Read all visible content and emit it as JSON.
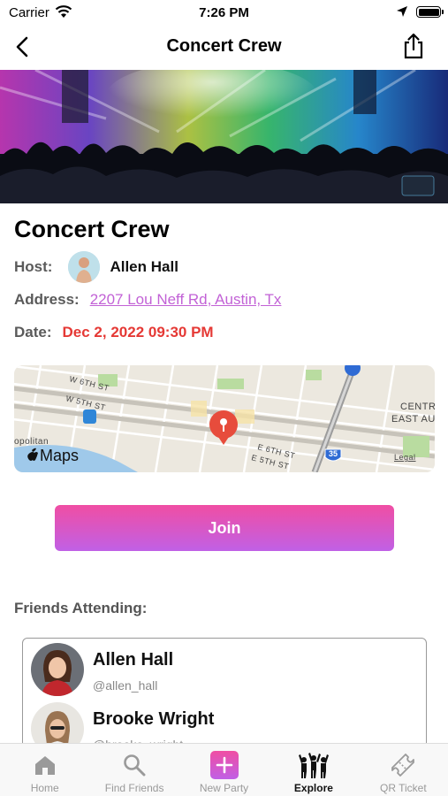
{
  "status_bar": {
    "carrier": "Carrier",
    "time": "7:26 PM"
  },
  "nav": {
    "title": "Concert Crew",
    "back_icon": "chevron-left-icon",
    "share_icon": "share-icon"
  },
  "event": {
    "title": "Concert Crew",
    "host_label": "Host:",
    "host_name": "Allen Hall",
    "address_label": "Address:",
    "address": "2207 Lou Neff Rd, Austin, Tx",
    "date_label": "Date:",
    "date": "Dec 2, 2022 09:30 PM"
  },
  "map": {
    "streets": [
      "W 6TH ST",
      "W 5TH ST",
      "E 6TH ST",
      "E 5TH ST"
    ],
    "places": [
      "CENTR",
      "EAST AU",
      "opolitan"
    ],
    "highway": "35",
    "brand": "Maps",
    "legal": "Legal"
  },
  "join_button": "Join",
  "friends": {
    "label": "Friends Attending:",
    "list": [
      {
        "name": "Allen Hall",
        "handle": "@allen_hall"
      },
      {
        "name": "Brooke Wright",
        "handle": "@brooke_wright"
      }
    ]
  },
  "tabs": [
    {
      "label": "Home",
      "icon": "home-icon",
      "active": false
    },
    {
      "label": "Find Friends",
      "icon": "search-icon",
      "active": false
    },
    {
      "label": "New Party",
      "icon": "plus-icon",
      "active": false
    },
    {
      "label": "Explore",
      "icon": "people-cheering-icon",
      "active": true
    },
    {
      "label": "QR Ticket",
      "icon": "ticket-icon",
      "active": false
    }
  ],
  "colors": {
    "accent_pink": "#f04ea3",
    "accent_purple": "#c060e6",
    "date_red": "#e53935",
    "link_purple": "#c262d6"
  }
}
